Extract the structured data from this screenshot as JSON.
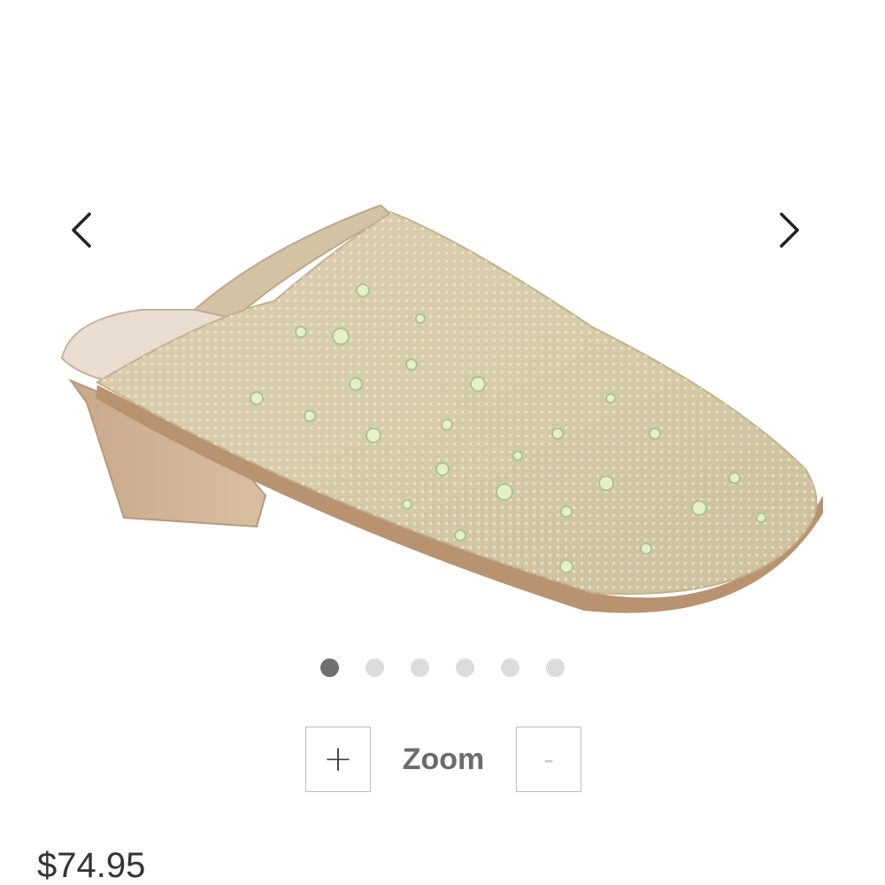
{
  "gallery": {
    "prev_icon": "chevron-left-icon",
    "next_icon": "chevron-right-icon",
    "image_alt": "",
    "dots": [
      {
        "active": true
      },
      {
        "active": false
      },
      {
        "active": false
      },
      {
        "active": false
      },
      {
        "active": false
      },
      {
        "active": false
      }
    ]
  },
  "zoom": {
    "plus_label": "+",
    "label": "Zoom",
    "minus_label": "-"
  },
  "product": {
    "price": "$74.95"
  },
  "colors": {
    "dot_active": "#6f6f6f",
    "dot_inactive": "#dcdcdc",
    "zoom_text": "#6b6b6b"
  }
}
